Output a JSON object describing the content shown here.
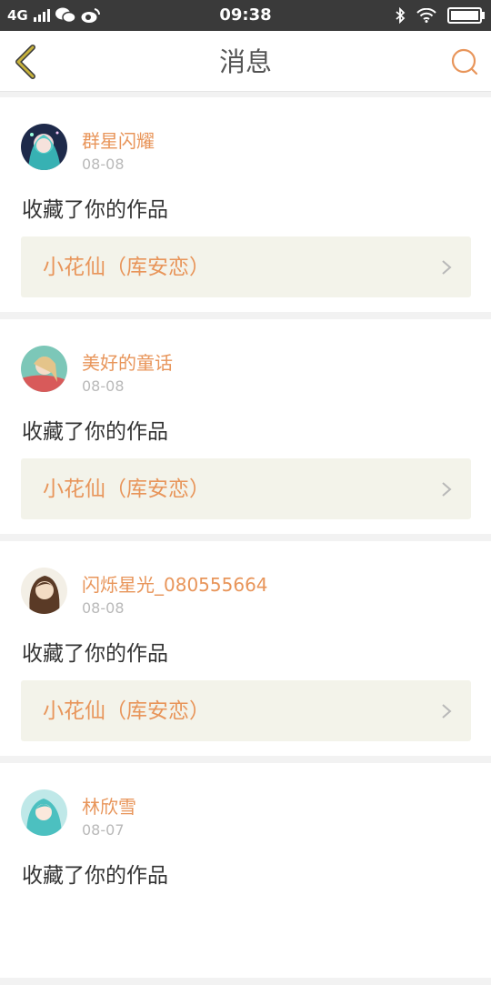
{
  "status_bar": {
    "network": "4G",
    "time": "09:38",
    "icons": [
      "signal-bars-icon",
      "wechat-icon",
      "weibo-icon",
      "bluetooth-icon",
      "wifi-icon",
      "battery-charging-icon"
    ]
  },
  "header": {
    "title": "消息",
    "back_icon": "chevron-left-icon",
    "search_icon": "search-icon"
  },
  "colors": {
    "accent": "#e8955a",
    "back_arrow": "#c7b23c",
    "card_bg": "#ffffff",
    "work_bg": "#f3f3ea",
    "page_bg": "#f2f2f2"
  },
  "messages": [
    {
      "username": "群星闪耀",
      "date": "08-08",
      "action": "收藏了你的作品",
      "work_title": "小花仙（库安恋）"
    },
    {
      "username": "美好的童话",
      "date": "08-08",
      "action": "收藏了你的作品",
      "work_title": "小花仙（库安恋）"
    },
    {
      "username": "闪烁星光_080555664",
      "date": "08-08",
      "action": "收藏了你的作品",
      "work_title": "小花仙（库安恋）"
    },
    {
      "username": "林欣雪",
      "date": "08-07",
      "action": "收藏了你的作品",
      "work_title": ""
    }
  ]
}
